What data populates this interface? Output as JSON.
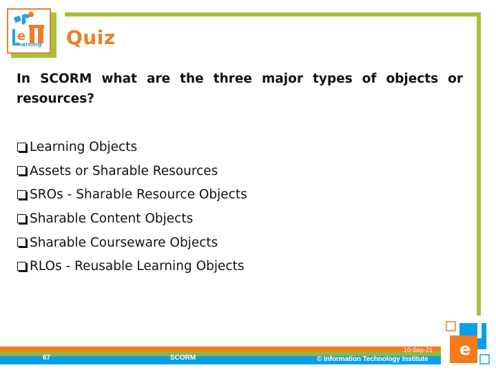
{
  "slide": {
    "title": "Quiz",
    "question": "In SCORM what are the three major types of objects or resources?",
    "options": [
      "Learning Objects",
      "Assets or Sharable Resources",
      "SROs - Sharable Resource Objects",
      "Sharable Content Objects",
      "Sharable Courseware Objects",
      "RLOs - Reusable Learning Objects"
    ],
    "bullet_icon": "checkbox-bullet-icon"
  },
  "logo": {
    "text": "eLearning",
    "letters_top": "TI",
    "colors": {
      "orange": "#f07c2a",
      "blue": "#2a9fd8",
      "green": "#a5c23a"
    }
  },
  "footer": {
    "page_number": "67",
    "title": "SCORM",
    "date": "10-Sep-21",
    "copyright": "© Information Technology Institute"
  },
  "colors": {
    "accent_orange": "#f07c2a",
    "accent_green": "#a5c23a",
    "accent_blue": "#0aa0e6"
  }
}
